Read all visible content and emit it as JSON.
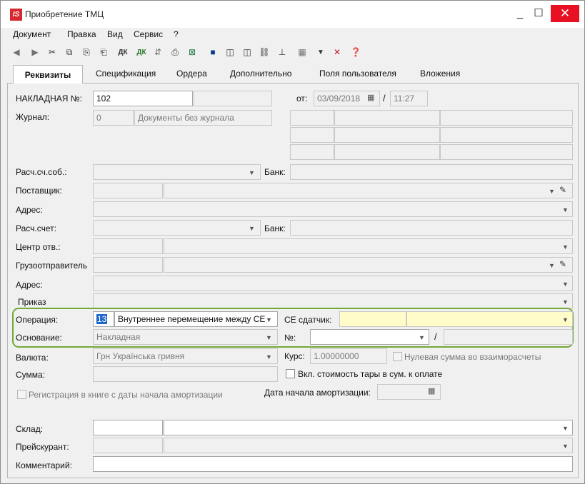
{
  "window": {
    "title": "Приобретение ТМЦ",
    "logo": "IS",
    "min_glyph": "_",
    "max_glyph": "☐",
    "close_glyph": "✕"
  },
  "menu": [
    "Документ",
    "Правка",
    "Вид",
    "Сервис",
    "?"
  ],
  "toolbar": {
    "items": [
      {
        "icon": "back-icon",
        "glyph": "◀"
      },
      {
        "icon": "forward-icon",
        "glyph": "▶"
      },
      {
        "icon": "cut-icon",
        "glyph": "✂"
      },
      {
        "icon": "copy-icon",
        "glyph": "⧉"
      },
      {
        "icon": "paste-icon",
        "glyph": "⎘"
      },
      {
        "icon": "paste-special-icon",
        "glyph": "⎗"
      },
      {
        "icon": "dk-icon",
        "glyph": "ДК"
      },
      {
        "icon": "dk-arrow-icon",
        "glyph": "ДК"
      },
      {
        "icon": "tax-icon",
        "glyph": "⇵"
      },
      {
        "icon": "print-icon",
        "glyph": "⎙"
      },
      {
        "icon": "excel-icon",
        "glyph": "⊠"
      },
      {
        "icon": "save-icon",
        "glyph": "■"
      },
      {
        "icon": "columns-icon",
        "glyph": "◫"
      },
      {
        "icon": "columns2-icon",
        "glyph": "◫"
      },
      {
        "icon": "link-icon",
        "glyph": "⛓"
      },
      {
        "icon": "tree-icon",
        "glyph": "⊥"
      },
      {
        "icon": "grid-icon",
        "glyph": "▦"
      },
      {
        "icon": "filter-icon",
        "glyph": "▼"
      },
      {
        "icon": "clear-filter-icon",
        "glyph": "✕"
      },
      {
        "icon": "help-icon",
        "glyph": "❓"
      }
    ]
  },
  "tabs": [
    "Реквизиты",
    "Спецификация",
    "Ордера",
    "Дополнительно",
    "Поля пользователя",
    "Вложения"
  ],
  "form": {
    "invoice_label": "НАКЛАДНАЯ №:",
    "invoice_number": "102",
    "date_from_label": "от:",
    "date_value": "03/09/2018",
    "time_value": "11:27",
    "date_sep": "/",
    "journal_label": "Журнал:",
    "journal_code": "0",
    "journal_name": "Документы без журнала",
    "own_account_label": "Расч.сч.соб.:",
    "bank_label": "Банк:",
    "supplier_label": "Поставщик:",
    "address_label": "Адрес:",
    "account_label": "Расч.счет:",
    "bank2_label": "Банк:",
    "resp_center_label": "Центр отв.:",
    "consignee_label": "Грузоотправитель",
    "address2_label": "Адрес:",
    "order_label": "Приказ",
    "operation_label": "Операция:",
    "operation_code": "13",
    "operation_name": "Внутреннее перемещение между СЕ",
    "se_sender_label": "СЕ сдатчик:",
    "basis_label": "Основание:",
    "basis_value": "Накладная",
    "basis_no_label": "№:",
    "basis_sep": "/",
    "currency_label": "Валюта:",
    "currency_value": "Грн Українська гривня",
    "rate_label": "Курс:",
    "rate_value": "1.00000000",
    "zero_sum_label": "Нулевая сумма во взаиморасчеты",
    "sum_label": "Сумма:",
    "tare_label": "Вкл. стоимость тары в сум. к оплате",
    "amort_reg_label": "Регистрация в книге с даты начала амортизации",
    "amort_date_label": "Дата начала амортизации:",
    "warehouse_label": "Склад:",
    "pricelist_label": "Прейскурант:",
    "comment_label": "Комментарий:"
  },
  "colors": {
    "accent_green": "#73a936",
    "highlight_yellow": "#fffcc9",
    "close_red": "#e81123"
  }
}
